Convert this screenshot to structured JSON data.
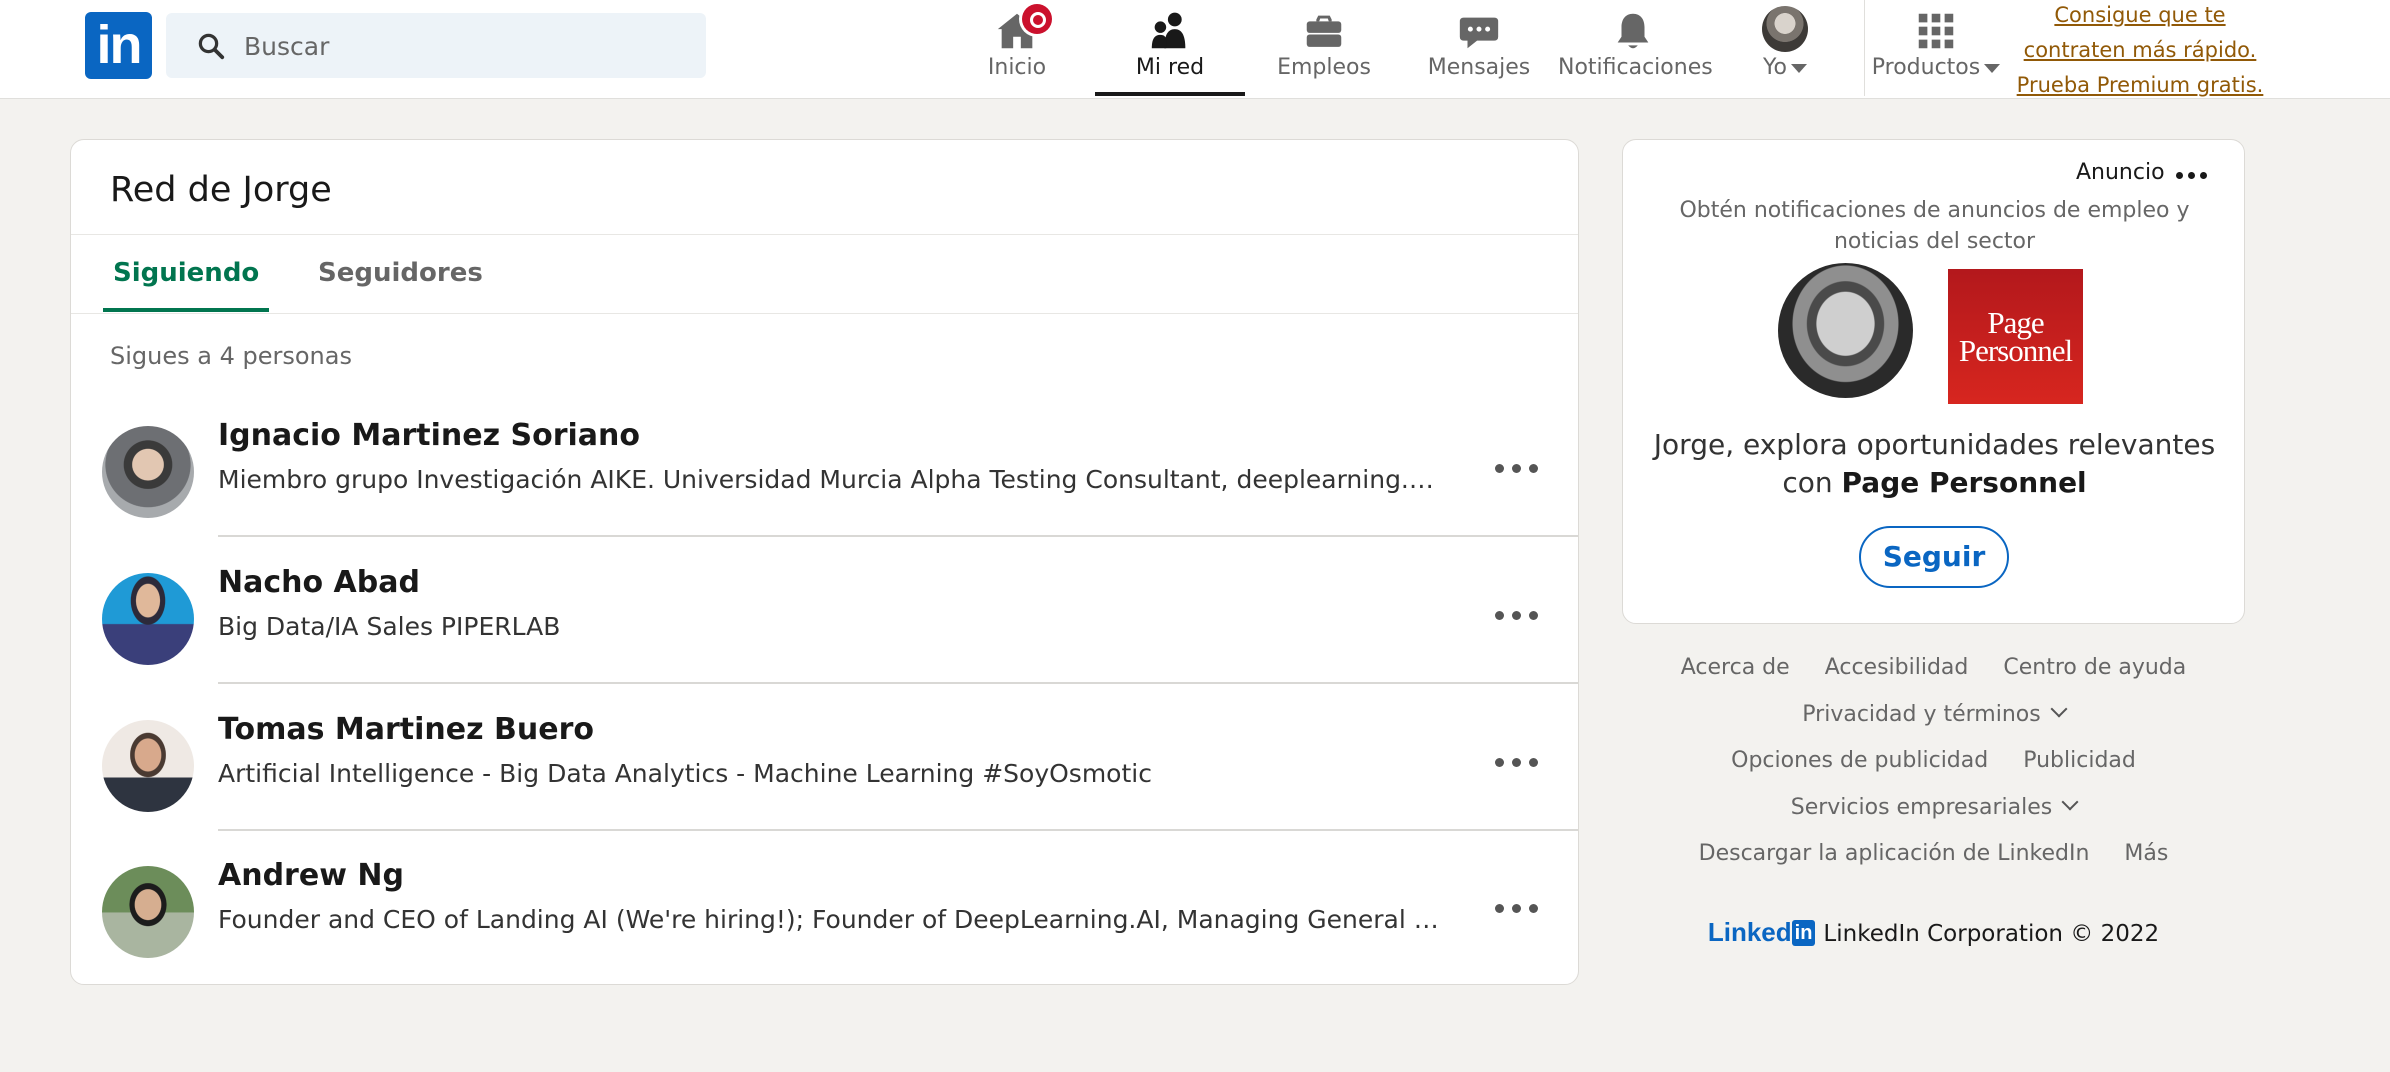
{
  "brand": {
    "logo_text": "in"
  },
  "search": {
    "placeholder": "Buscar"
  },
  "nav": {
    "home": "Inicio",
    "network": "Mi red",
    "jobs": "Empleos",
    "messages": "Mensajes",
    "notifications": "Notificaciones",
    "me": "Yo",
    "products": "Productos"
  },
  "premium": {
    "line1": "Consigue que te",
    "line2": "contraten más rápido.",
    "line3": "Prueba Premium gratis."
  },
  "network_card": {
    "title": "Red de Jorge",
    "tabs": [
      "Siguiendo",
      "Seguidores"
    ],
    "count_text": "Sigues a 4 personas",
    "people": [
      {
        "name": "Ignacio Martinez Soriano",
        "headline": "Miembro grupo Investigación AIKE. Universidad Murcia Alpha Testing Consultant, deeplearning.ai (D..."
      },
      {
        "name": "Nacho Abad",
        "headline": "Big Data/IA Sales PIPERLAB"
      },
      {
        "name": "Tomas Martinez Buero",
        "headline": "Artificial Intelligence - Big Data Analytics - Machine Learning #SoyOsmotic"
      },
      {
        "name": "Andrew Ng",
        "headline": "Founder and CEO of Landing AI (We're hiring!); Founder of DeepLearning.AI, Managing General Part..."
      }
    ]
  },
  "ad": {
    "label": "Anuncio",
    "subtitle": "Obtén notificaciones de anuncios de empleo y noticias del sector",
    "logo_line1": "Page",
    "logo_line2": "Personnel",
    "message_prefix": "Jorge, explora oportunidades relevantes con",
    "company": "Page Personnel",
    "follow_label": "Seguir"
  },
  "footer": {
    "links_row1": [
      "Acerca de",
      "Accesibilidad",
      "Centro de ayuda"
    ],
    "privacy": "Privacidad y términos",
    "links_row3": [
      "Opciones de publicidad",
      "Publicidad"
    ],
    "business": "Servicios empresariales",
    "links_row5": [
      "Descargar la aplicación de LinkedIn",
      "Más"
    ],
    "logo_word": "Linked",
    "logo_box": "in",
    "copyright": "LinkedIn Corporation © 2022"
  },
  "colors": {
    "brand_blue": "#0a66c2",
    "active_green": "#01754f",
    "premium_gold": "#915907",
    "badge_red": "#cb112d",
    "page_bg": "#f3f2ef"
  }
}
